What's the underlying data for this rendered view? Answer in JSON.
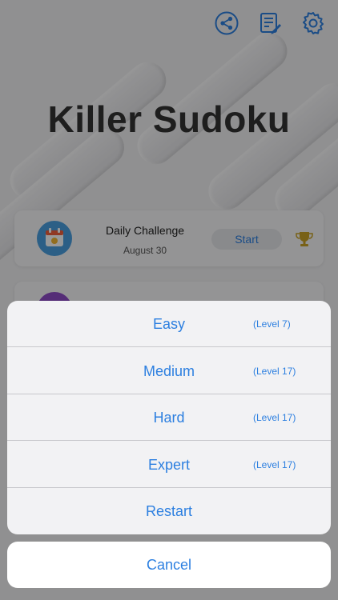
{
  "header": {
    "title": "Killer Sudoku",
    "icons": [
      "share-icon",
      "notes-edit-icon",
      "gear-icon"
    ]
  },
  "daily_challenge": {
    "title": "Daily Challenge",
    "date": "August 30",
    "start_label": "Start",
    "icons": [
      "calendar-icon",
      "trophy-icon"
    ]
  },
  "action_sheet": {
    "options": [
      {
        "label": "Easy",
        "level": "(Level 7)"
      },
      {
        "label": "Medium",
        "level": "(Level 17)"
      },
      {
        "label": "Hard",
        "level": "(Level 17)"
      },
      {
        "label": "Expert",
        "level": "(Level 17)"
      }
    ],
    "restart_label": "Restart",
    "cancel_label": "Cancel"
  },
  "colors": {
    "accent": "#2c7fe0",
    "title_text": "#333333",
    "avatar_blue": "#4a9fe0",
    "avatar_purple": "#8e4cc7",
    "trophy_gold": "#c9a227"
  }
}
